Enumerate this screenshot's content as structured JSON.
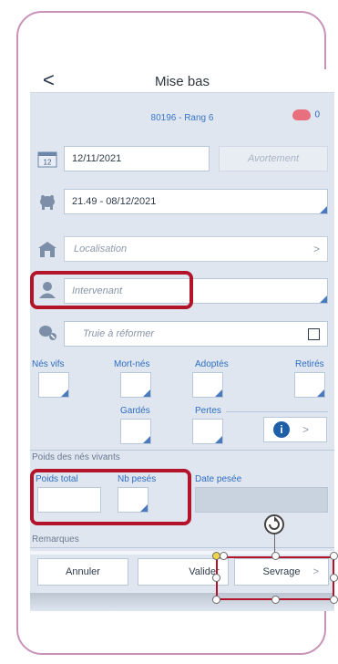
{
  "header": {
    "title": "Mise bas",
    "back": "<"
  },
  "animal": {
    "id_rank": "80196 - Rang 6",
    "pig_count": "0"
  },
  "date_row": {
    "date": "12/11/2021",
    "calendar_day": "12",
    "avortement_label": "Avortement"
  },
  "due_row": {
    "value": "21.49 - 08/12/2021"
  },
  "location": {
    "placeholder": "Localisation",
    "chevron": ">"
  },
  "intervenant": {
    "placeholder": "Intervenant"
  },
  "reform": {
    "label": "Truie à réformer"
  },
  "counts": {
    "nes_vifs": "Nés vifs",
    "mort_nes": "Mort-nés",
    "adoptes": "Adoptés",
    "retires": "Retirés",
    "gardes": "Gardés",
    "pertes": "Pertes",
    "info_chev": ">"
  },
  "weights": {
    "section": "Poids des nés vivants",
    "total": "Poids total",
    "nb_peses": "Nb pesés",
    "date_pesee": "Date pesée"
  },
  "remarks": {
    "label": "Remarques"
  },
  "actions": {
    "annuler": "Annuler",
    "valider": "Valider",
    "sevrage": "Sevrage",
    "sevrage_chev": ">"
  },
  "colors": {
    "accent": "#2f6ec0",
    "highlight": "#b3142a",
    "frame": "#c793b8"
  }
}
